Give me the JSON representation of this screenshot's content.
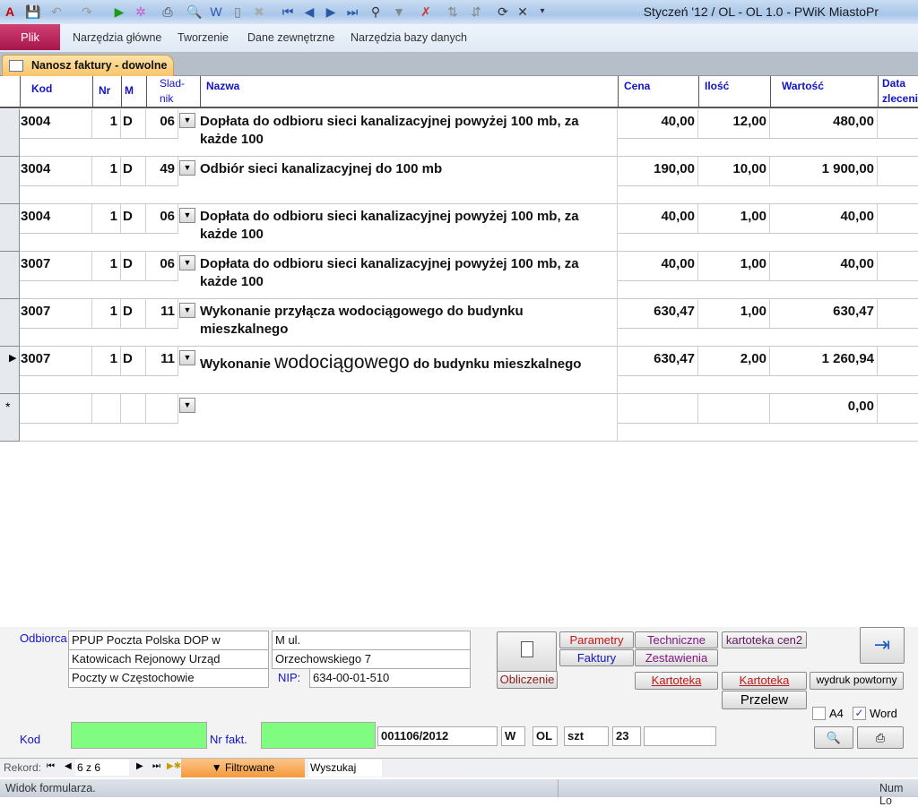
{
  "window": {
    "title": "Styczeń '12 / OL - OL 1.0 - PWiK MiastoPr"
  },
  "ribbon": {
    "file_tab": "Plik",
    "tabs": [
      "Narzędzia główne",
      "Tworzenie",
      "Dane zewnętrzne",
      "Narzędzia bazy danych"
    ]
  },
  "document_tab": {
    "label": "Nanosz faktury - dowolne"
  },
  "grid": {
    "headers": {
      "kod": "Kod",
      "nr": "Nr",
      "m": "M",
      "skladnik": "Slad-\nnik",
      "nazwa": "Nazwa",
      "cena": "Cena",
      "ilosc": "Ilość",
      "wartosc": "Wartość",
      "data": "Data zleceni"
    },
    "rows": [
      {
        "kod": "3004",
        "nr": "1",
        "m": "D",
        "sk": "06",
        "nazwa": "Dopłata do odbioru sieci kanalizacyjnej powyżej 100 mb, za każde 100",
        "cena": "40,00",
        "ilosc": "12,00",
        "wartosc": "480,00"
      },
      {
        "kod": "3004",
        "nr": "1",
        "m": "D",
        "sk": "49",
        "nazwa": "Odbiór sieci kanalizacyjnej do 100 mb",
        "cena": "190,00",
        "ilosc": "10,00",
        "wartosc": "1 900,00"
      },
      {
        "kod": "3004",
        "nr": "1",
        "m": "D",
        "sk": "06",
        "nazwa": "Dopłata do odbioru sieci kanalizacyjnej powyżej 100 mb, za każde 100",
        "cena": "40,00",
        "ilosc": "1,00",
        "wartosc": "40,00"
      },
      {
        "kod": "3007",
        "nr": "1",
        "m": "D",
        "sk": "06",
        "nazwa": "Dopłata do odbioru sieci kanalizacyjnej powyżej 100 mb, za każde 100",
        "cena": "40,00",
        "ilosc": "1,00",
        "wartosc": "40,00"
      },
      {
        "kod": "3007",
        "nr": "1",
        "m": "D",
        "sk": "11",
        "nazwa": "Wykonanie przyłącza wodociągowego do budynku mieszkalnego",
        "cena": "630,47",
        "ilosc": "1,00",
        "wartosc": "630,47"
      }
    ],
    "current_row": {
      "kod": "3007",
      "nr": "1",
      "m": "D",
      "sk": "11",
      "nazwa_a": "Wykonanie ",
      "nazwa_b": "wodociągowego",
      "nazwa_c": " do budynku mieszkalnego",
      "cena": "630,47",
      "ilosc": "2,00",
      "wartosc": "1 260,94"
    },
    "new_row": {
      "marker": "*",
      "wartosc": "0,00"
    }
  },
  "form": {
    "odbiorca_label": "Odbiorca",
    "odbiorca": [
      "PPUP Poczta Polska DOP w",
      "Katowicach Rejonowy Urząd",
      "Poczty w Częstochowie"
    ],
    "adres": [
      "M ul.",
      "Orzechowskiego 7"
    ],
    "nip_label": "NIP:",
    "nip": "634-00-01-510",
    "kod_label": "Kod",
    "nr_fakt_label": "Nr fakt.",
    "invoice_no": "001106/2012",
    "w": "W",
    "ol": "OL",
    "unit": "szt",
    "num": "23",
    "buttons": {
      "parametry": "Parametry",
      "techniczne": "Techniczne",
      "kartoteka_cen2": "kartoteka cen2",
      "faktury": "Faktury",
      "zestawienia": "Zestawienia",
      "obliczenie": "Obliczenie",
      "kartoteka1": "Kartoteka",
      "kartoteka2": "Kartoteka",
      "wydruk": "wydruk powtorny",
      "przelew": "Przelew"
    },
    "a4_label": "A4",
    "a4_checked": false,
    "word_label": "Word",
    "word_checked": true
  },
  "navbar": {
    "rekord_label": "Rekord:",
    "position": "6 z 6",
    "filter": "Filtrowane",
    "search": "Wyszukaj"
  },
  "status": {
    "left": "Widok formularza.",
    "right": "Num Lo"
  },
  "colors": {
    "plik": "#b8205a",
    "header_text": "#1212c8",
    "green_field": "#80fc80",
    "filter": "#f5a54a"
  }
}
